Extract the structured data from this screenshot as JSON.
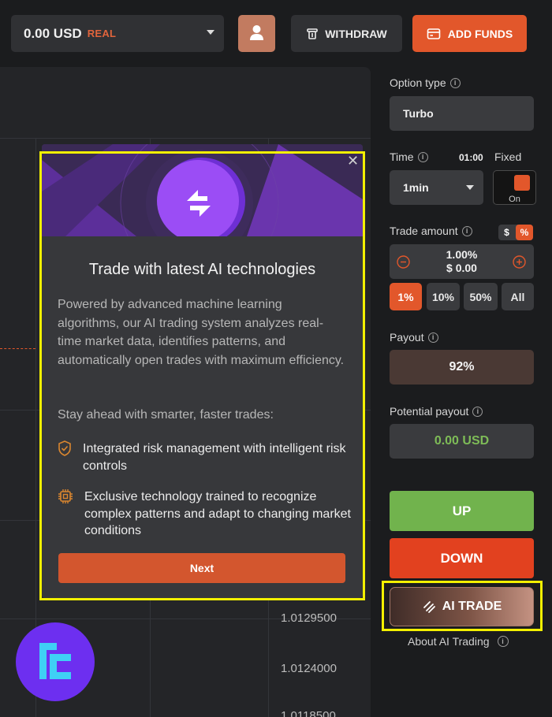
{
  "header": {
    "balance_amount": "0.00 USD",
    "account_type": "REAL",
    "withdraw_label": "WITHDRAW",
    "add_funds_label": "ADD FUNDS"
  },
  "chart": {
    "y_ticks": [
      "1.0129500",
      "1.0124000",
      "1.0118500"
    ]
  },
  "trade_panel": {
    "option_type_label": "Option type",
    "option_type_value": "Turbo",
    "time_label": "Time",
    "time_countdown": "01:00",
    "fixed_label": "Fixed",
    "time_value": "1min",
    "toggle_label": "On",
    "trade_amount_label": "Trade amount",
    "currency_symbol": "$",
    "percent_symbol": "%",
    "amount_percent": "1.00%",
    "amount_value": "$ 0.00",
    "percent_options": [
      "1%",
      "10%",
      "50%",
      "All"
    ],
    "payout_label": "Payout",
    "payout_value": "92%",
    "potential_payout_label": "Potential payout",
    "potential_payout_value": "0.00 USD",
    "up_label": "UP",
    "down_label": "DOWN",
    "ai_trade_label": "AI TRADE",
    "about_ai_label": "About AI Trading"
  },
  "popup": {
    "title": "Trade with latest AI technologies",
    "description": "Powered by advanced machine learning algorithms, our AI trading system analyzes real-time market data, identifies patterns, and automatically open trades with maximum efficiency.",
    "subheading": "Stay ahead with smarter, faster trades:",
    "features": [
      "Integrated risk management with intelligent risk controls",
      "Exclusive technology trained to recognize complex patterns and adapt to changing market conditions"
    ],
    "next_label": "Next"
  },
  "colors": {
    "accent_orange": "#e2572b",
    "up_green": "#71b34d",
    "down_red": "#e2411f",
    "highlight_yellow": "#f3f000",
    "ai_purple": "#8a3df0"
  },
  "icons": [
    "user-icon",
    "withdraw-icon",
    "wallet-icon",
    "chevron-down-icon",
    "info-icon",
    "minus-icon",
    "plus-icon",
    "ai-sync-icon",
    "shield-check-icon",
    "chip-icon",
    "close-icon",
    "brand-logo"
  ]
}
